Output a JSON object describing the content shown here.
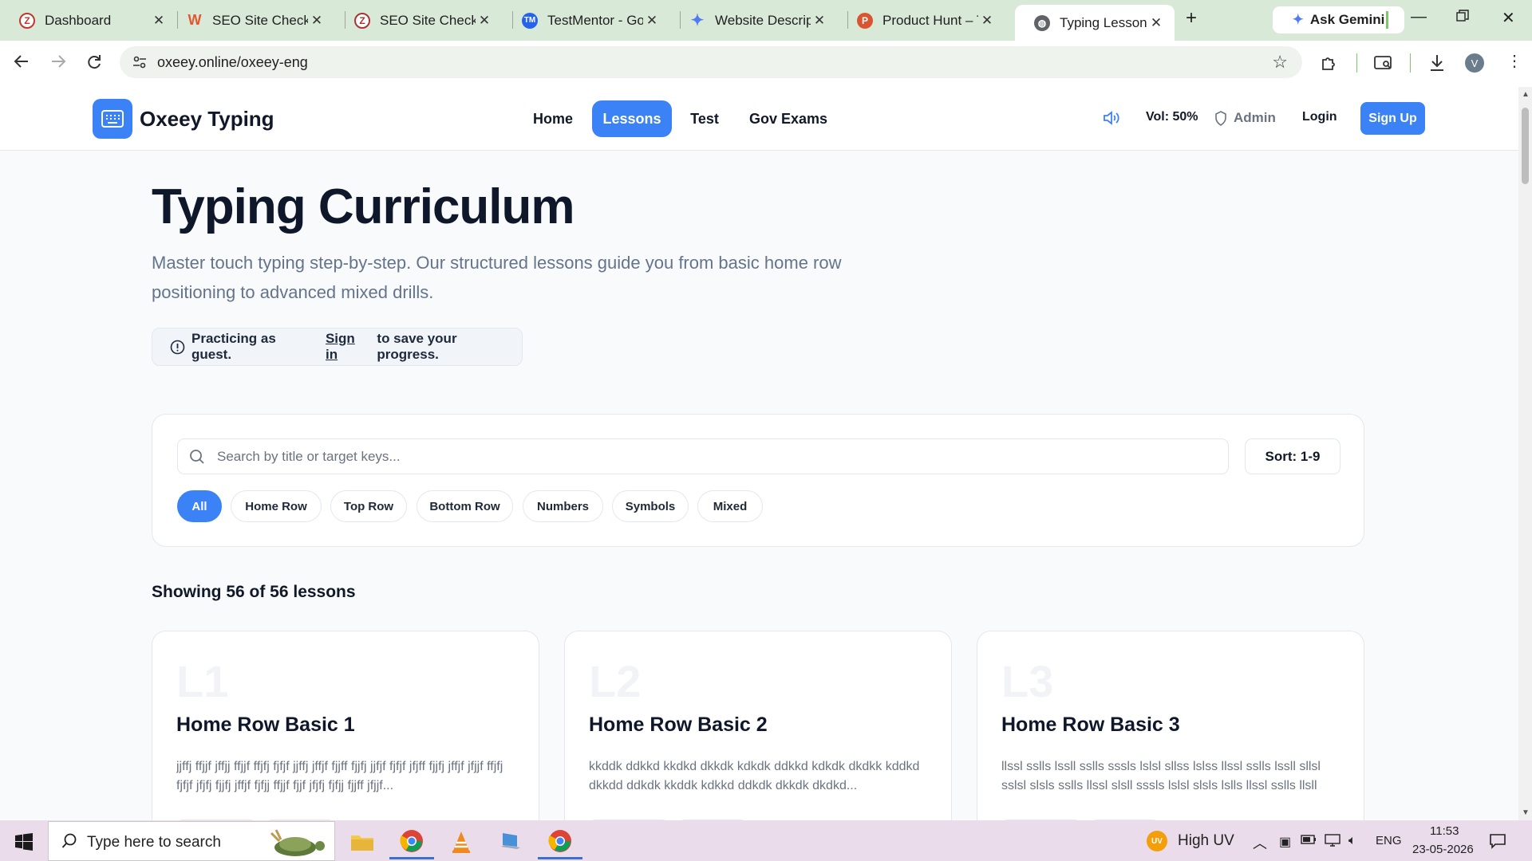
{
  "browser": {
    "tabs": [
      {
        "title": "Dashboard",
        "favicon": "dashboard-favicon",
        "color": "#c0392b"
      },
      {
        "title": "SEO Site Checkup",
        "favicon": "seo-favicon",
        "color": "#e4572e"
      },
      {
        "title": "SEO Site Checkup",
        "favicon": "seo-favicon",
        "color": "#a33"
      },
      {
        "title": "TestMentor - Gove",
        "favicon": "testmentor-favicon",
        "color": "#2563eb"
      },
      {
        "title": "Website Descriptio",
        "favicon": "gemini-favicon",
        "color": "#4f7cf5"
      },
      {
        "title": "Product Hunt – Th",
        "favicon": "producthunt-favicon",
        "color": "#da552f"
      },
      {
        "title": "Typing Lessons - C",
        "favicon": "globe-favicon",
        "color": "#5f6368"
      }
    ],
    "ask_gemini": "Ask Gemini",
    "url": "oxeey.online/oxeey-eng",
    "profile_initial": "V"
  },
  "site": {
    "brand": "Oxeey Typing",
    "nav": [
      "Home",
      "Lessons",
      "Test",
      "Gov Exams"
    ],
    "active_nav": "Lessons",
    "volume": "Vol: 50%",
    "admin": "Admin",
    "login": "Login",
    "signup": "Sign Up"
  },
  "hero": {
    "title": "Typing Curriculum",
    "subtitle": "Master touch typing step-by-step. Our structured lessons guide you from basic home row positioning to advanced mixed drills.",
    "guest_prefix": "Practicing as guest.",
    "guest_link": "Sign in",
    "guest_suffix": "to save your progress."
  },
  "filters": {
    "search_placeholder": "Search by title or target keys...",
    "sort": "Sort: 1-9",
    "chips": [
      "All",
      "Home Row",
      "Top Row",
      "Bottom Row",
      "Numbers",
      "Symbols",
      "Mixed"
    ],
    "active_chip": "All"
  },
  "showing": "Showing 56 of 56 lessons",
  "lessons": [
    {
      "badge": "L1",
      "title": "Home Row Basic 1",
      "keys": "jjffj ffjjf jffjj ffjjf ffjfj fjfjf jjffj jffjf fjjff fjjfj jjfjf fjfjf jfjff fjjfj jffjf jfjjf ffjfj fjfjf jfjfj fjjfj jffjf fjfjj ffjjf fjjf jfjfj fjfjj fjjff jfjjf..."
    },
    {
      "badge": "L2",
      "title": "Home Row Basic 2",
      "keys": "kkddk ddkkd kkdkd dkkdk kdkdk ddkkd kdkdk dkdkk kddkd dkkdd ddkdk kkddk kdkkd ddkdk dkkdk dkdkd..."
    },
    {
      "badge": "L3",
      "title": "Home Row Basic 3",
      "keys": "llssl sslls lssll sslls sssls lslsl sllss lslss llssl sslls lssll sllsl sslsl slsls sslls llssl slsll sssls lslsl slsls lslls llssl sslls llsll sslls lslls..."
    }
  ],
  "taskbar": {
    "search_placeholder": "Type here to search",
    "weather": "High UV",
    "weather_badge": "UV",
    "lang": "ENG",
    "time": "11:53",
    "date": "23-05-2026"
  }
}
